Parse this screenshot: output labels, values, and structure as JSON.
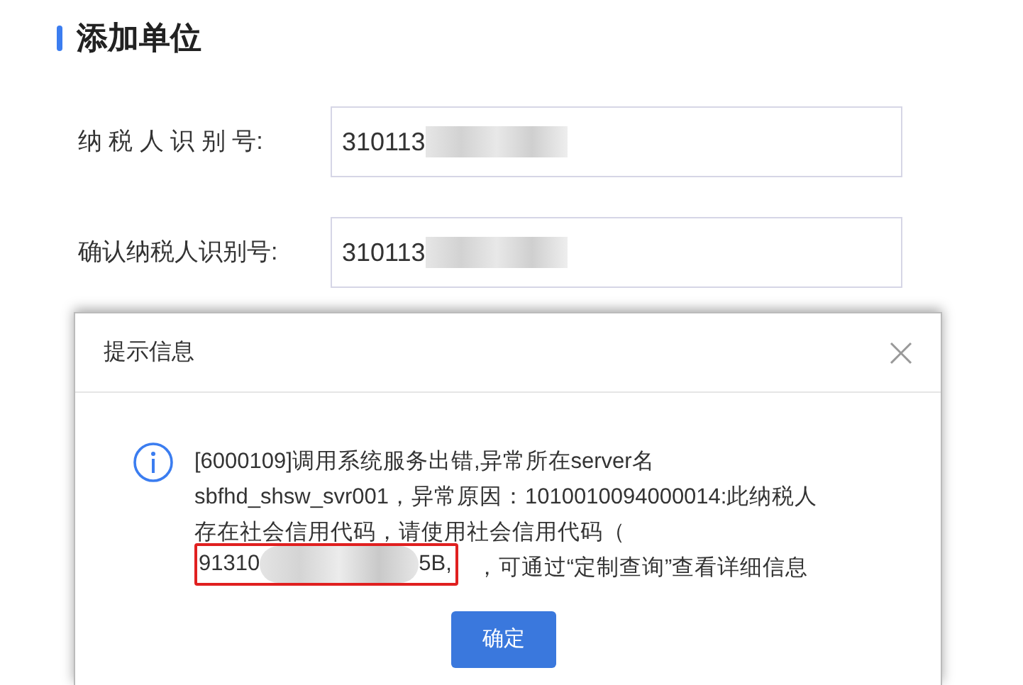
{
  "page": {
    "title": "添加单位"
  },
  "fields": [
    {
      "label": "纳 税 人 识 别 号:",
      "value": "310113",
      "redacted": true
    },
    {
      "label": "确认纳税人识别号:",
      "value": "310113",
      "redacted": true
    }
  ],
  "dialog": {
    "title": "提示信息",
    "message_lines": [
      "[6000109]调用系统服务出错,异常所在server名",
      "sbfhd_shsw_svr001，异常原因：1010010094000014:此纳税人",
      "存在社会信用代码，请使用社会信用代码（"
    ],
    "code_start": "91310",
    "code_end": "5B,",
    "code_highlighted": true,
    "tail": "，可通过“定制查询”查看详细信息",
    "button": "确定"
  }
}
